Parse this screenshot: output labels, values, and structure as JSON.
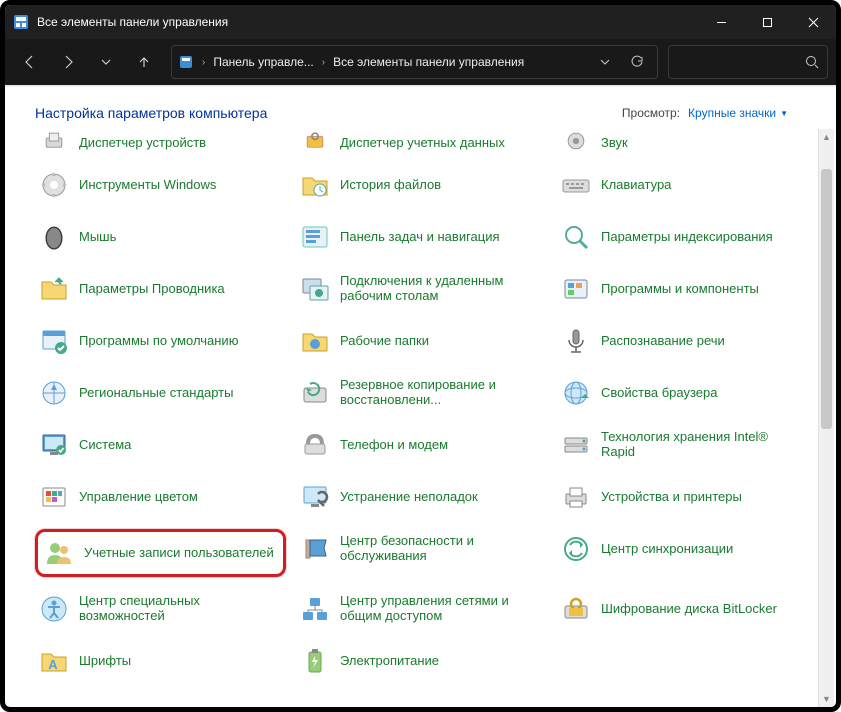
{
  "titlebar": {
    "title": "Все элементы панели управления"
  },
  "breadcrumb": {
    "crumb1": "Панель управле...",
    "crumb2": "Все элементы панели управления"
  },
  "header": {
    "title": "Настройка параметров компьютера",
    "view_label": "Просмотр:",
    "view_value": "Крупные значки"
  },
  "items": {
    "r0c0": "Диспетчер устройств",
    "r0c1": "Диспетчер учетных данных",
    "r0c2": "Звук",
    "r1c0": "Инструменты Windows",
    "r1c1": "История файлов",
    "r1c2": "Клавиатура",
    "r2c0": "Мышь",
    "r2c1": "Панель задач и навигация",
    "r2c2": "Параметры индексирования",
    "r3c0": "Параметры Проводника",
    "r3c1": "Подключения к удаленным рабочим столам",
    "r3c2": "Программы и компоненты",
    "r4c0": "Программы по умолчанию",
    "r4c1": "Рабочие папки",
    "r4c2": "Распознавание речи",
    "r5c0": "Региональные стандарты",
    "r5c1": "Резервное копирование и восстановлени...",
    "r5c2": "Свойства браузера",
    "r6c0": "Система",
    "r6c1": "Телефон и модем",
    "r6c2": "Технология хранения Intel® Rapid",
    "r7c0": "Управление цветом",
    "r7c1": "Устранение неполадок",
    "r7c2": "Устройства и принтеры",
    "r8c0": "Учетные записи пользователей",
    "r8c1": "Центр безопасности и обслуживания",
    "r8c2": "Центр синхронизации",
    "r9c0": "Центр специальных возможностей",
    "r9c1": "Центр управления сетями и общим доступом",
    "r9c2": "Шифрование диска BitLocker",
    "r10c0": "Шрифты",
    "r10c1": "Электропитание"
  }
}
